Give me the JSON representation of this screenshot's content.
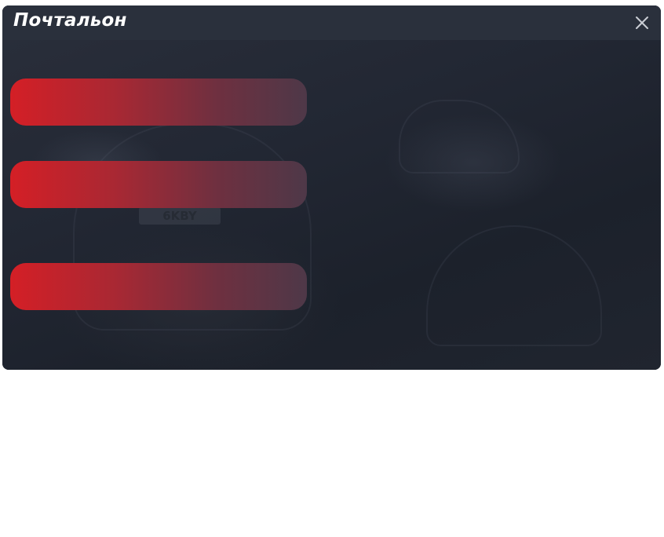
{
  "window": {
    "title": "Почтальон",
    "close_icon": "close-icon"
  },
  "background": {
    "plate_text": "6KBY"
  },
  "actions": [
    {
      "label": ""
    },
    {
      "label": ""
    },
    {
      "label": ""
    }
  ],
  "colors": {
    "accent_start": "#d41f26",
    "accent_end": "#4e3848",
    "panel": "#1d222d",
    "titlebar": "#2a303c"
  }
}
